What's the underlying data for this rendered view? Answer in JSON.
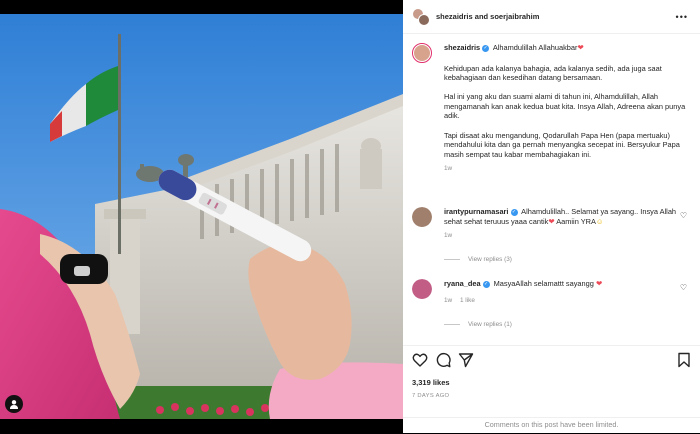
{
  "header": {
    "title": "shezaidris and soerjaibrahim",
    "more_icon": "more-horizontal-icon"
  },
  "caption": {
    "username": "shezaidris",
    "first_line": "Alhamdulillah Allahuakbar",
    "paragraphs": [
      "Kehidupan ada kalanya bahagia, ada kalanya sedih, ada juga saat kebahagiaan dan kesedihan datang bersamaan.",
      "Hal ini yang aku dan suami alami di tahun ini, Alhamdulillah, Allah mengamanah kan anak kedua buat kita. Insya Allah, Adreena akan punya adik.",
      "Tapi disaat aku mengandung, Qodarullah Papa Hen (papa mertuaku) mendahului kita dan ga pernah menyangka secepat ini. Bersyukur Papa masih sempat tau kabar membahagiakan ini."
    ],
    "time": "1w"
  },
  "comments": [
    {
      "username": "irantypurnamasari",
      "text": "Alhamdulillah.. Selamat ya sayang.. Insya Allah sehat sehat teruuus yaaa cantik",
      "text_tail": " Aamiin YRA",
      "time": "1w",
      "likes": "",
      "replies": "View replies (3)"
    },
    {
      "username": "ryana_dea",
      "text": "MasyaAllah selamattt sayangg",
      "time": "1w",
      "likes": "1 like",
      "replies": "View replies (1)"
    }
  ],
  "actions": {
    "like_icon": "heart-icon",
    "comment_icon": "comment-icon",
    "share_icon": "share-icon",
    "save_icon": "bookmark-icon",
    "likes": "3,319 likes",
    "posted": "7 DAYS AGO",
    "limited": "Comments on this post have been limited."
  },
  "colors": {
    "verified": "#3897f0",
    "heart": "#ed4956",
    "muted": "#8e8e8e",
    "text": "#262626"
  }
}
